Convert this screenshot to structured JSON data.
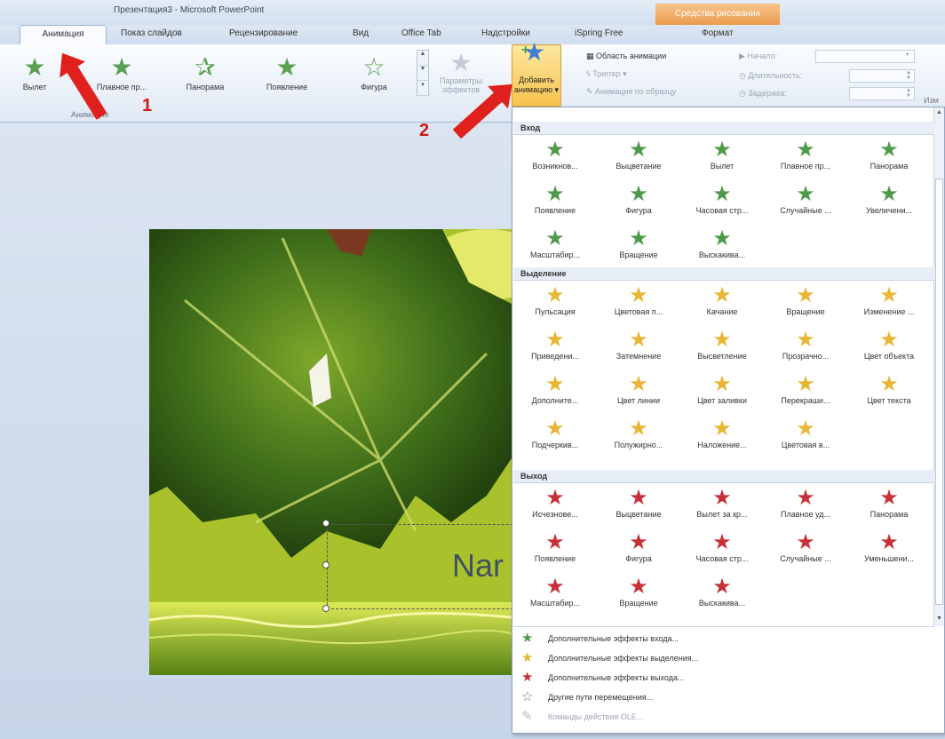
{
  "title_bar": {
    "title": "Презентация3 - Microsoft PowerPoint",
    "context_tab": "Средства рисования"
  },
  "tabs": [
    "Анимация",
    "Показ слайдов",
    "Рецензирование",
    "Вид",
    "Office Tab",
    "Надстройки",
    "iSpring Free",
    "Формат"
  ],
  "ribbon": {
    "gallery": [
      "Вылет",
      "Плавное пр...",
      "Панорама",
      "Появление",
      "Фигура"
    ],
    "group_label": "Анимация",
    "params_label": "Параметры эффектов",
    "add_animation": "Добавить анимацию",
    "commands": [
      "Область анимации",
      "Триггер",
      "Анимация по образцу"
    ],
    "timing": [
      "Начало:",
      "Длительность:",
      "Задержка:"
    ],
    "right_cut": "Изм"
  },
  "annotations": {
    "n1": "1",
    "n2": "2"
  },
  "slide": {
    "text": "Nar"
  },
  "dropdown": {
    "sections": [
      {
        "title": "Вход",
        "items": [
          "Возникнов...",
          "Выцветание",
          "Вылет",
          "Плавное пр...",
          "Панорама",
          "Появление",
          "Фигура",
          "Часовая стр...",
          "Случайные ...",
          "Увеличени...",
          "Масштабир...",
          "Вращение",
          "Выскакива..."
        ]
      },
      {
        "title": "Выделение",
        "items": [
          "Пульсация",
          "Цветовая п...",
          "Качание",
          "Вращение",
          "Изменение ...",
          "Приведени...",
          "Затемнение",
          "Высветление",
          "Прозрачно...",
          "Цвет объекта",
          "Дополните...",
          "Цвет линии",
          "Цвет заливки",
          "Перекраши...",
          "Цвет текста",
          "Подчеркив...",
          "Полужирно...",
          "Наложение...",
          "Цветовая в..."
        ]
      },
      {
        "title": "Выход",
        "items": [
          "Исчезнове...",
          "Выцветание",
          "Вылет за кр...",
          "Плавное уд...",
          "Панорама",
          "Появление",
          "Фигура",
          "Часовая стр...",
          "Случайные ...",
          "Уменьшени...",
          "Масштабир...",
          "Вращение",
          "Выскакива..."
        ]
      }
    ],
    "menu": [
      "Дополнительные эффекты входа...",
      "Дополнительные эффекты выделения...",
      "Дополнительные эффекты выхода...",
      "Другие пути перемещения...",
      "Команды действия OLE..."
    ]
  },
  "colors": {
    "entrance": "#4f9a4a",
    "emphasis": "#e9b634",
    "exit": "#c8313a",
    "accent": "#f7c34f"
  }
}
